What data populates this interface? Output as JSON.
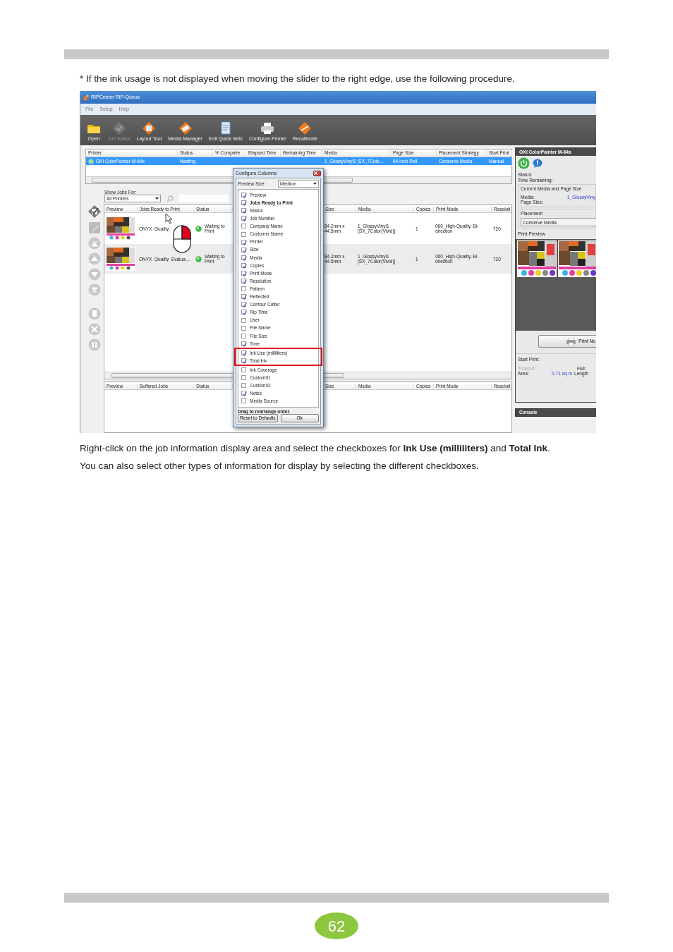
{
  "page": {
    "intro": "* If the ink usage is not displayed when moving the slider to the right edge, use the following procedure.",
    "caption": [
      "Right-click on the job information display area and select the checkboxes for **Ink Use (milliliters)** and **Total Ink**.",
      "You can also select other types of information for display by selecting the different checkboxes."
    ],
    "page_number": "62"
  },
  "window": {
    "title": "RIPCenter RIP-Queue"
  },
  "menu": [
    {
      "label": "File"
    },
    {
      "label": "Setup"
    },
    {
      "label": "Help"
    }
  ],
  "toolbar": [
    {
      "label": "Open",
      "kind": "folder",
      "disabled": false
    },
    {
      "label": "Job Editor",
      "kind": "jobedit",
      "disabled": true
    },
    {
      "label": "Layout Tool",
      "kind": "layout",
      "disabled": false
    },
    {
      "label": "Media Manager",
      "kind": "media",
      "disabled": false
    },
    {
      "label": "Edit Quick Sets",
      "kind": "document",
      "disabled": false
    },
    {
      "label": "Configure Printer",
      "kind": "printer",
      "disabled": false
    },
    {
      "label": "Recalibrate",
      "kind": "recalibrate",
      "disabled": false
    }
  ],
  "printer_table": {
    "columns": [
      "Printer",
      "Status",
      "% Complete",
      "Elapsed Time",
      "Remaining Time",
      "Media",
      "Page Size",
      "Placement Strategy",
      "Start Print"
    ],
    "rows": [
      {
        "selected": true,
        "cells": [
          "OKI ColorPainter M-64s",
          "Nesting",
          null,
          null,
          null,
          "1_GlossyVinyl1 [SX_7Colo…",
          "64 Inch Roll",
          "Conserve Media",
          "Manual"
        ]
      }
    ]
  },
  "job_filter": {
    "label": "Show Jobs For:",
    "value": "All Printers"
  },
  "jobs_table": {
    "columns": [
      "Preview",
      "Jobs Ready to Print",
      "Status",
      "Size",
      "Media",
      "Copies",
      "Print Mode",
      "Resoluti"
    ],
    "rows": [
      {
        "cells": [
          "",
          "ONYX_Quality_",
          "Waiting to Print",
          "84.2mm x 44.5mm",
          "1_GlossyVinyl1 [SX_7Color(Vivid)]",
          "1",
          "060_High-Quality, Bi-direction",
          "720"
        ]
      },
      {
        "cells": [
          "",
          "ONYX_Quality_Evalua…",
          "Waiting to Print",
          "84.2mm x 44.5mm",
          "1_GlossyVinyl1 [SX_7Color(Vivid)]",
          "1",
          "060_High-Quality, Bi-direction",
          "720"
        ]
      }
    ]
  },
  "buffered_table": {
    "columns": [
      "Preview",
      "Buffered Jobs",
      "Status",
      "Size",
      "Media",
      "Copies",
      "Print Mode",
      "Resoluti"
    ]
  },
  "dialog": {
    "title": "Configure Columns",
    "preview_size_label": "Preview Size:",
    "preview_size": "Medium",
    "columns": [
      {
        "label": "Preview",
        "checked": true,
        "bold": false,
        "highlighted": false
      },
      {
        "label": "Jobs Ready to Print",
        "checked": true,
        "bold": true,
        "highlighted": false
      },
      {
        "label": "Status",
        "checked": true,
        "bold": false,
        "highlighted": false
      },
      {
        "label": "Job Number",
        "checked": true,
        "bold": false,
        "highlighted": false
      },
      {
        "label": "Company Name",
        "checked": false,
        "bold": false,
        "highlighted": false
      },
      {
        "label": "Customer Name",
        "checked": false,
        "bold": false,
        "highlighted": false
      },
      {
        "label": "Printer",
        "checked": true,
        "bold": false,
        "highlighted": false
      },
      {
        "label": "Size",
        "checked": true,
        "bold": false,
        "highlighted": false
      },
      {
        "label": "Media",
        "checked": true,
        "bold": false,
        "highlighted": false
      },
      {
        "label": "Copies",
        "checked": true,
        "bold": false,
        "highlighted": false
      },
      {
        "label": "Print Mode",
        "checked": true,
        "bold": false,
        "highlighted": false
      },
      {
        "label": "Resolution",
        "checked": true,
        "bold": false,
        "highlighted": false
      },
      {
        "label": "Pattern",
        "checked": false,
        "bold": false,
        "highlighted": false
      },
      {
        "label": "Reflected",
        "checked": true,
        "bold": false,
        "highlighted": false
      },
      {
        "label": "Contour Cutter",
        "checked": true,
        "bold": false,
        "highlighted": false
      },
      {
        "label": "Rip Time",
        "checked": true,
        "bold": false,
        "highlighted": false
      },
      {
        "label": "User",
        "checked": false,
        "bold": false,
        "highlighted": false
      },
      {
        "label": "File Name",
        "checked": false,
        "bold": false,
        "highlighted": false
      },
      {
        "label": "File Size",
        "checked": false,
        "bold": false,
        "highlighted": false
      },
      {
        "label": "Time",
        "checked": true,
        "bold": false,
        "highlighted": false
      },
      {
        "label": "Ink Use (milliliters)",
        "checked": true,
        "bold": false,
        "highlighted": true
      },
      {
        "label": "Total Ink",
        "checked": true,
        "bold": false,
        "highlighted": true
      },
      {
        "label": "Ink Coverage",
        "checked": false,
        "bold": false,
        "highlighted": false
      },
      {
        "label": "Custom01",
        "checked": false,
        "bold": false,
        "highlighted": false
      },
      {
        "label": "Custom02",
        "checked": false,
        "bold": false,
        "highlighted": false
      },
      {
        "label": "Notes",
        "checked": true,
        "bold": false,
        "highlighted": false
      },
      {
        "label": "Media Source",
        "checked": false,
        "bold": false,
        "highlighted": false
      }
    ],
    "hint": "Drag to rearrange order.",
    "buttons": [
      "Reset to Defaults",
      "Ok"
    ]
  },
  "printer_panel": {
    "title": "OKI ColorPainter M-64s",
    "status_label": "Status:",
    "time_remaining_label": "Time Remaining:",
    "media_group_title": "Current Media and Page Size",
    "media_label": "Media:",
    "media_value": "1_GlossyViny",
    "page_size_label": "Page Size:",
    "placement_title": "Placement",
    "placement_value": "Conserve Media",
    "print_preview_label": "Print Preview",
    "print_button": "Print No",
    "start_print_label": "Start Print:",
    "timeout_label": "Timeout:",
    "full_label": "Full:",
    "area_label": "Area:",
    "area_value": "0.71 sq m",
    "length_label": "Length"
  },
  "console": {
    "title": "Console"
  }
}
